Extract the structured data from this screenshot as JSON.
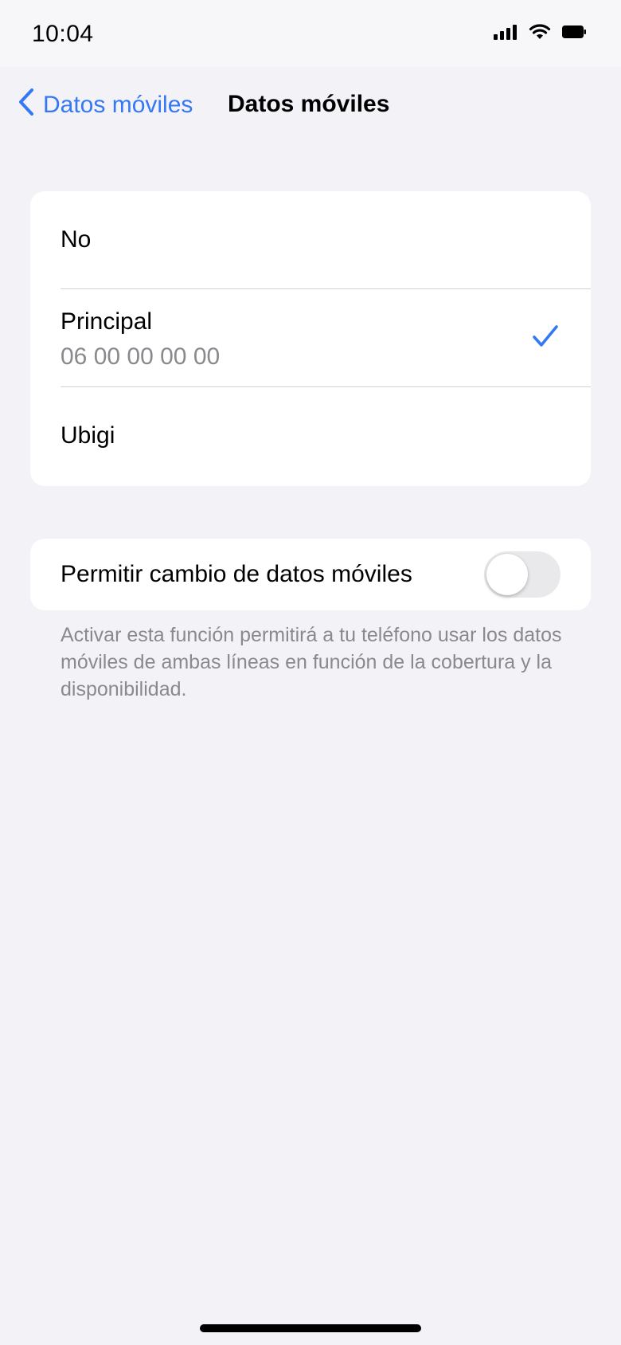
{
  "status_bar": {
    "time": "10:04",
    "icons": [
      "cellular-signal-icon",
      "wifi-icon",
      "battery-icon"
    ]
  },
  "nav": {
    "back_label": "Datos móviles",
    "title": "Datos móviles"
  },
  "options": [
    {
      "label": "No",
      "selected": false
    },
    {
      "label": "Principal",
      "sublabel": "06 00 00 00 00",
      "selected": true
    },
    {
      "label": "Ubigi",
      "selected": false
    }
  ],
  "data_switch": {
    "label": "Permitir cambio de datos móviles",
    "enabled": false,
    "footer": "Activar esta función permitirá a tu teléfono usar los datos móviles de ambas líneas en función de la cobertura y la disponibilidad."
  },
  "colors": {
    "accent": "#3478f6",
    "background": "#f2f2f7",
    "secondary_text": "#8a8a8e"
  }
}
